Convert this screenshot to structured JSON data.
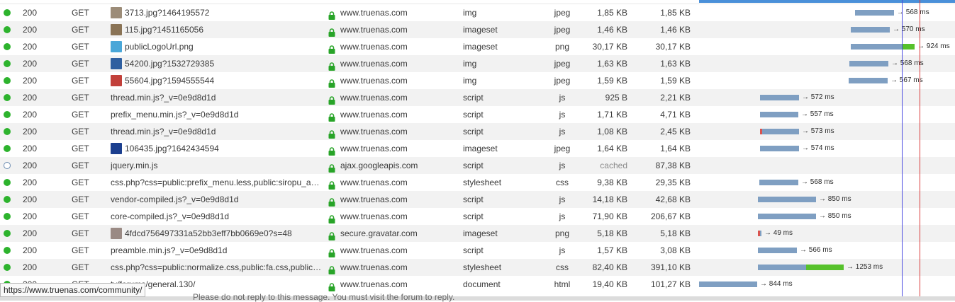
{
  "colors": {
    "status_ok": "#2db32d",
    "lock": "#28a428",
    "bar_wait": "#7f9fc2",
    "bar_receive": "#56c12b",
    "row_alt": "#f2f2f2",
    "line_blue": "#4a4ae0",
    "line_red": "#d93a3a"
  },
  "requests": [
    {
      "status": "200",
      "method": "GET",
      "file": "3713.jpg?1464195572",
      "thumb": "#9c8c78",
      "domain": "www.truenas.com",
      "cause": "img",
      "type": "jpeg",
      "transferred": "1,85 KB",
      "size": "1,85 KB",
      "start": 220,
      "wait": 55,
      "recv": 0,
      "duration": "→ 568 ms"
    },
    {
      "status": "200",
      "method": "GET",
      "file": "115.jpg?1451165056",
      "thumb": "#8a7355",
      "domain": "www.truenas.com",
      "cause": "imageset",
      "type": "jpeg",
      "transferred": "1,46 KB",
      "size": "1,46 KB",
      "start": 214,
      "wait": 55,
      "recv": 0,
      "duration": "→ 570 ms"
    },
    {
      "status": "200",
      "method": "GET",
      "file": "publicLogoUrl.png",
      "thumb": "#4aa7d8",
      "domain": "www.truenas.com",
      "cause": "imageset",
      "type": "png",
      "transferred": "30,17 KB",
      "size": "30,17 KB",
      "start": 214,
      "wait": 72,
      "recv": 18,
      "duration": "→ 924 ms"
    },
    {
      "status": "200",
      "method": "GET",
      "file": "54200.jpg?1532729385",
      "thumb": "#2f5fa0",
      "domain": "www.truenas.com",
      "cause": "img",
      "type": "jpeg",
      "transferred": "1,63 KB",
      "size": "1,63 KB",
      "start": 212,
      "wait": 55,
      "recv": 0,
      "duration": "→ 568 ms"
    },
    {
      "status": "200",
      "method": "GET",
      "file": "55604.jpg?1594555544",
      "thumb": "#c2403a",
      "domain": "www.truenas.com",
      "cause": "img",
      "type": "jpeg",
      "transferred": "1,59 KB",
      "size": "1,59 KB",
      "start": 211,
      "wait": 55,
      "recv": 0,
      "duration": "→ 567 ms"
    },
    {
      "status": "200",
      "method": "GET",
      "file": "thread.min.js?_v=0e9d8d1d",
      "thumb": "",
      "domain": "www.truenas.com",
      "cause": "script",
      "type": "js",
      "transferred": "925 B",
      "size": "2,21 KB",
      "start": 86,
      "wait": 55,
      "recv": 0,
      "duration": "→ 572 ms"
    },
    {
      "status": "200",
      "method": "GET",
      "file": "prefix_menu.min.js?_v=0e9d8d1d",
      "thumb": "",
      "domain": "www.truenas.com",
      "cause": "script",
      "type": "js",
      "transferred": "1,71 KB",
      "size": "4,71 KB",
      "start": 86,
      "wait": 54,
      "recv": 0,
      "duration": "→ 557 ms"
    },
    {
      "status": "200",
      "method": "GET",
      "file": "thread.min.js?_v=0e9d8d1d",
      "thumb": "",
      "domain": "www.truenas.com",
      "cause": "script",
      "type": "js",
      "transferred": "1,08 KB",
      "size": "2,45 KB",
      "start": 86,
      "wait": 55,
      "recv": 0,
      "duration": "→ 573 ms",
      "red": true
    },
    {
      "status": "200",
      "method": "GET",
      "file": "106435.jpg?1642434594",
      "thumb": "#1c3f8f",
      "domain": "www.truenas.com",
      "cause": "imageset",
      "type": "jpeg",
      "transferred": "1,64 KB",
      "size": "1,64 KB",
      "start": 86,
      "wait": 55,
      "recv": 0,
      "duration": "→ 574 ms"
    },
    {
      "status": "200",
      "method": "GET",
      "file": "jquery.min.js",
      "thumb": "",
      "domain": "ajax.googleapis.com",
      "cause": "script",
      "type": "js",
      "transferred": "cached",
      "size": "87,38 KB",
      "start": 0,
      "wait": 0,
      "recv": 0,
      "duration": "",
      "hollow": true
    },
    {
      "status": "200",
      "method": "GET",
      "file": "css.php?css=public:prefix_menu.less,public:siropu_ads…",
      "thumb": "",
      "domain": "www.truenas.com",
      "cause": "stylesheet",
      "type": "css",
      "transferred": "9,38 KB",
      "size": "29,35 KB",
      "start": 85,
      "wait": 55,
      "recv": 0,
      "duration": "→ 568 ms"
    },
    {
      "status": "200",
      "method": "GET",
      "file": "vendor-compiled.js?_v=0e9d8d1d",
      "thumb": "",
      "domain": "www.truenas.com",
      "cause": "script",
      "type": "js",
      "transferred": "14,18 KB",
      "size": "42,68 KB",
      "start": 83,
      "wait": 82,
      "recv": 0,
      "duration": "→ 850 ms"
    },
    {
      "status": "200",
      "method": "GET",
      "file": "core-compiled.js?_v=0e9d8d1d",
      "thumb": "",
      "domain": "www.truenas.com",
      "cause": "script",
      "type": "js",
      "transferred": "71,90 KB",
      "size": "206,67 KB",
      "start": 83,
      "wait": 82,
      "recv": 0,
      "duration": "→ 850 ms"
    },
    {
      "status": "200",
      "method": "GET",
      "file": "4fdcd756497331a52bb3eff7bb0669e0?s=48",
      "thumb": "#9a8a84",
      "domain": "secure.gravatar.com",
      "cause": "imageset",
      "type": "png",
      "transferred": "5,18 KB",
      "size": "5,18 KB",
      "start": 83,
      "wait": 5,
      "recv": 0,
      "duration": "→ 49 ms",
      "red": true
    },
    {
      "status": "200",
      "method": "GET",
      "file": "preamble.min.js?_v=0e9d8d1d",
      "thumb": "",
      "domain": "www.truenas.com",
      "cause": "script",
      "type": "js",
      "transferred": "1,57 KB",
      "size": "3,08 KB",
      "start": 83,
      "wait": 55,
      "recv": 0,
      "duration": "→ 566 ms"
    },
    {
      "status": "200",
      "method": "GET",
      "file": "css.php?css=public:normalize.css,public:fa.css,public:…",
      "thumb": "",
      "domain": "www.truenas.com",
      "cause": "stylesheet",
      "type": "css",
      "transferred": "82,40 KB",
      "size": "391,10 KB",
      "start": 83,
      "wait": 68,
      "recv": 53,
      "duration": "→ 1253 ms"
    },
    {
      "status": "200",
      "method": "GET",
      "file": "ty/forums/general.130/",
      "thumb": "",
      "domain": "www.truenas.com",
      "cause": "document",
      "type": "html",
      "transferred": "19,40 KB",
      "size": "101,27 KB",
      "start": 0,
      "wait": 82,
      "recv": 0,
      "duration": "→ 844 ms"
    }
  ],
  "tooltip": "https://www.truenas.com/community/",
  "background_text": "Please do not reply to this message. You must visit the forum to reply."
}
